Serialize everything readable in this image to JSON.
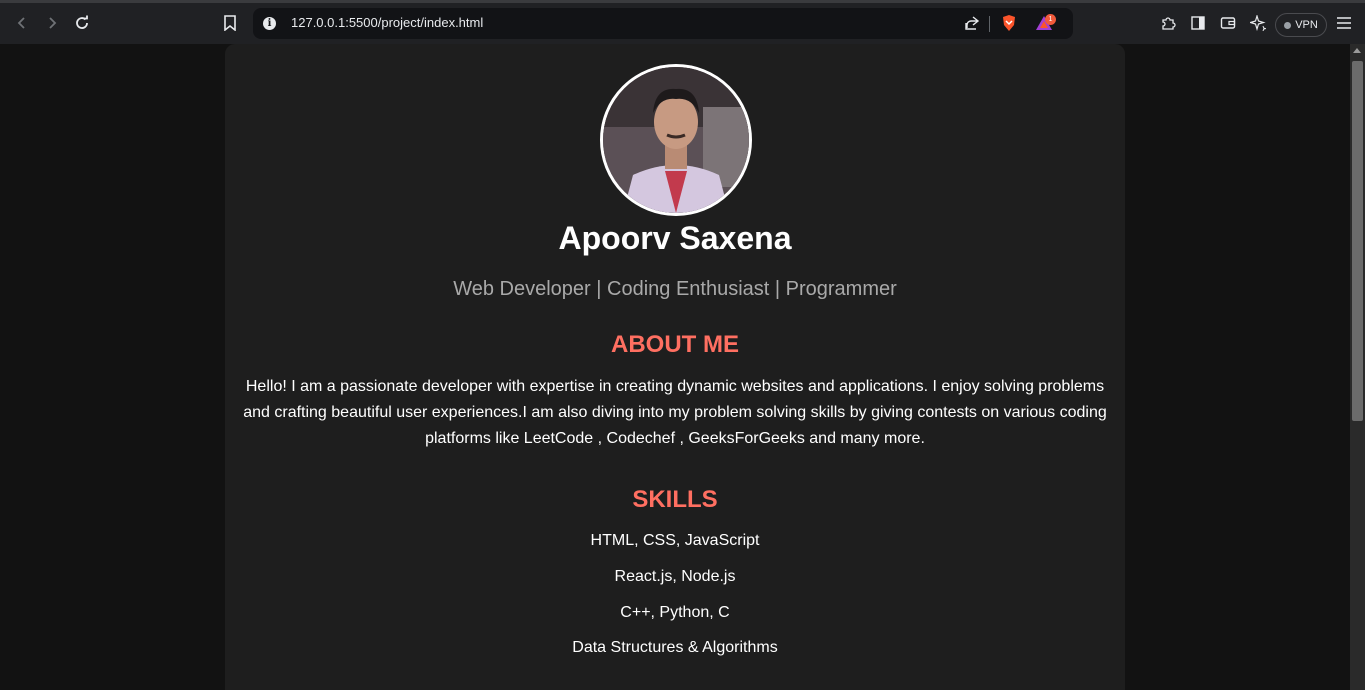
{
  "browser": {
    "url": "127.0.0.1:5500/project/index.html",
    "vpn_label": "VPN",
    "notification_count": "1"
  },
  "profile": {
    "name": "Apoorv Saxena",
    "tagline": "Web Developer | Coding Enthusiast | Programmer"
  },
  "about": {
    "heading": "ABOUT ME",
    "text": "Hello! I am a passionate developer with expertise in creating dynamic websites and applications. I enjoy solving problems and crafting beautiful user experiences.I am also diving into my problem solving skills by giving contests on various coding platforms like LeetCode , Codechef , GeeksForGeeks and many more."
  },
  "skills": {
    "heading": "SKILLS",
    "items": [
      "HTML, CSS, JavaScript",
      "React.js, Node.js",
      "C++, Python, C",
      "Data Structures & Algorithms"
    ]
  },
  "colors": {
    "accent": "#ff6f61",
    "card_bg": "#1e1e1e",
    "page_bg": "#121212"
  }
}
